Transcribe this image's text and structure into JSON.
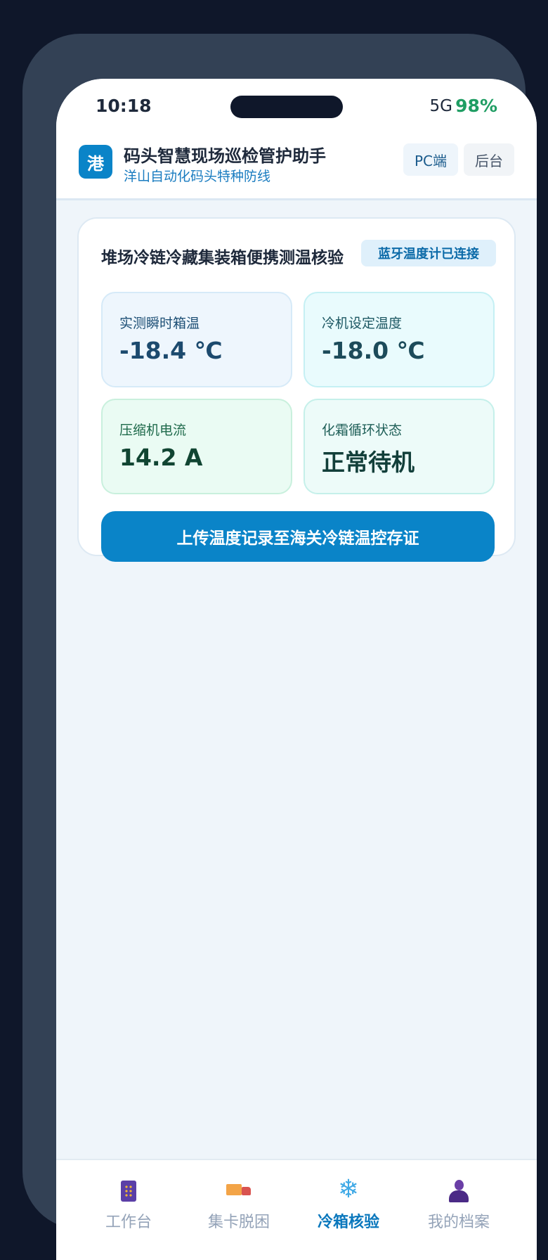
{
  "status_bar": {
    "time": "10:18",
    "network": "5G",
    "battery": "98%"
  },
  "header": {
    "logo_char": "港",
    "title": "码头智慧现场巡检管护助手",
    "subtitle": "洋山自动化码头特种防线",
    "pc_button": "PC端",
    "admin_button": "后台"
  },
  "card": {
    "title": "堆场冷链冷藏集装箱便携测温核验",
    "bluetooth_badge": "蓝牙温度计已连接",
    "metrics": [
      {
        "label": "实测瞬时箱温",
        "value": "-18.4 ℃"
      },
      {
        "label": "冷机设定温度",
        "value": "-18.0 ℃"
      },
      {
        "label": "压缩机电流",
        "value": "14.2 A"
      },
      {
        "label": "化霜循环状态",
        "value": "正常待机"
      }
    ],
    "upload_button": "上传温度记录至海关冷链温控存证"
  },
  "tabbar": {
    "active": "冷箱核验",
    "tabs": [
      {
        "label": "工作台",
        "icon": "dashboard-panel-icon"
      },
      {
        "label": "集卡脱困",
        "icon": "truck-icon"
      },
      {
        "label": "冷箱核验",
        "icon": "snowflake-icon"
      },
      {
        "label": "我的档案",
        "icon": "user-icon"
      }
    ]
  },
  "colors": {
    "accent": "#0a84c8",
    "battery": "#1f9d63",
    "background": "#0f172a"
  }
}
